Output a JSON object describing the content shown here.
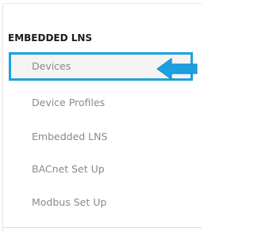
{
  "sidebar": {
    "section_title": "EMBEDDED LNS",
    "items": [
      {
        "label": "Devices",
        "active": true
      },
      {
        "label": "Device Profiles",
        "active": false
      },
      {
        "label": "Embedded LNS",
        "active": false
      },
      {
        "label": "BACnet Set Up",
        "active": false
      },
      {
        "label": "Modbus Set Up",
        "active": false
      }
    ]
  },
  "annotation": {
    "arrow_icon": "left-arrow-icon",
    "arrow_color": "#1ba1e2"
  },
  "colors": {
    "accent": "#1ba1e2",
    "active_background": "#f3f3f3",
    "item_text": "#8a8a8a",
    "heading_text": "#1b1b1b"
  }
}
